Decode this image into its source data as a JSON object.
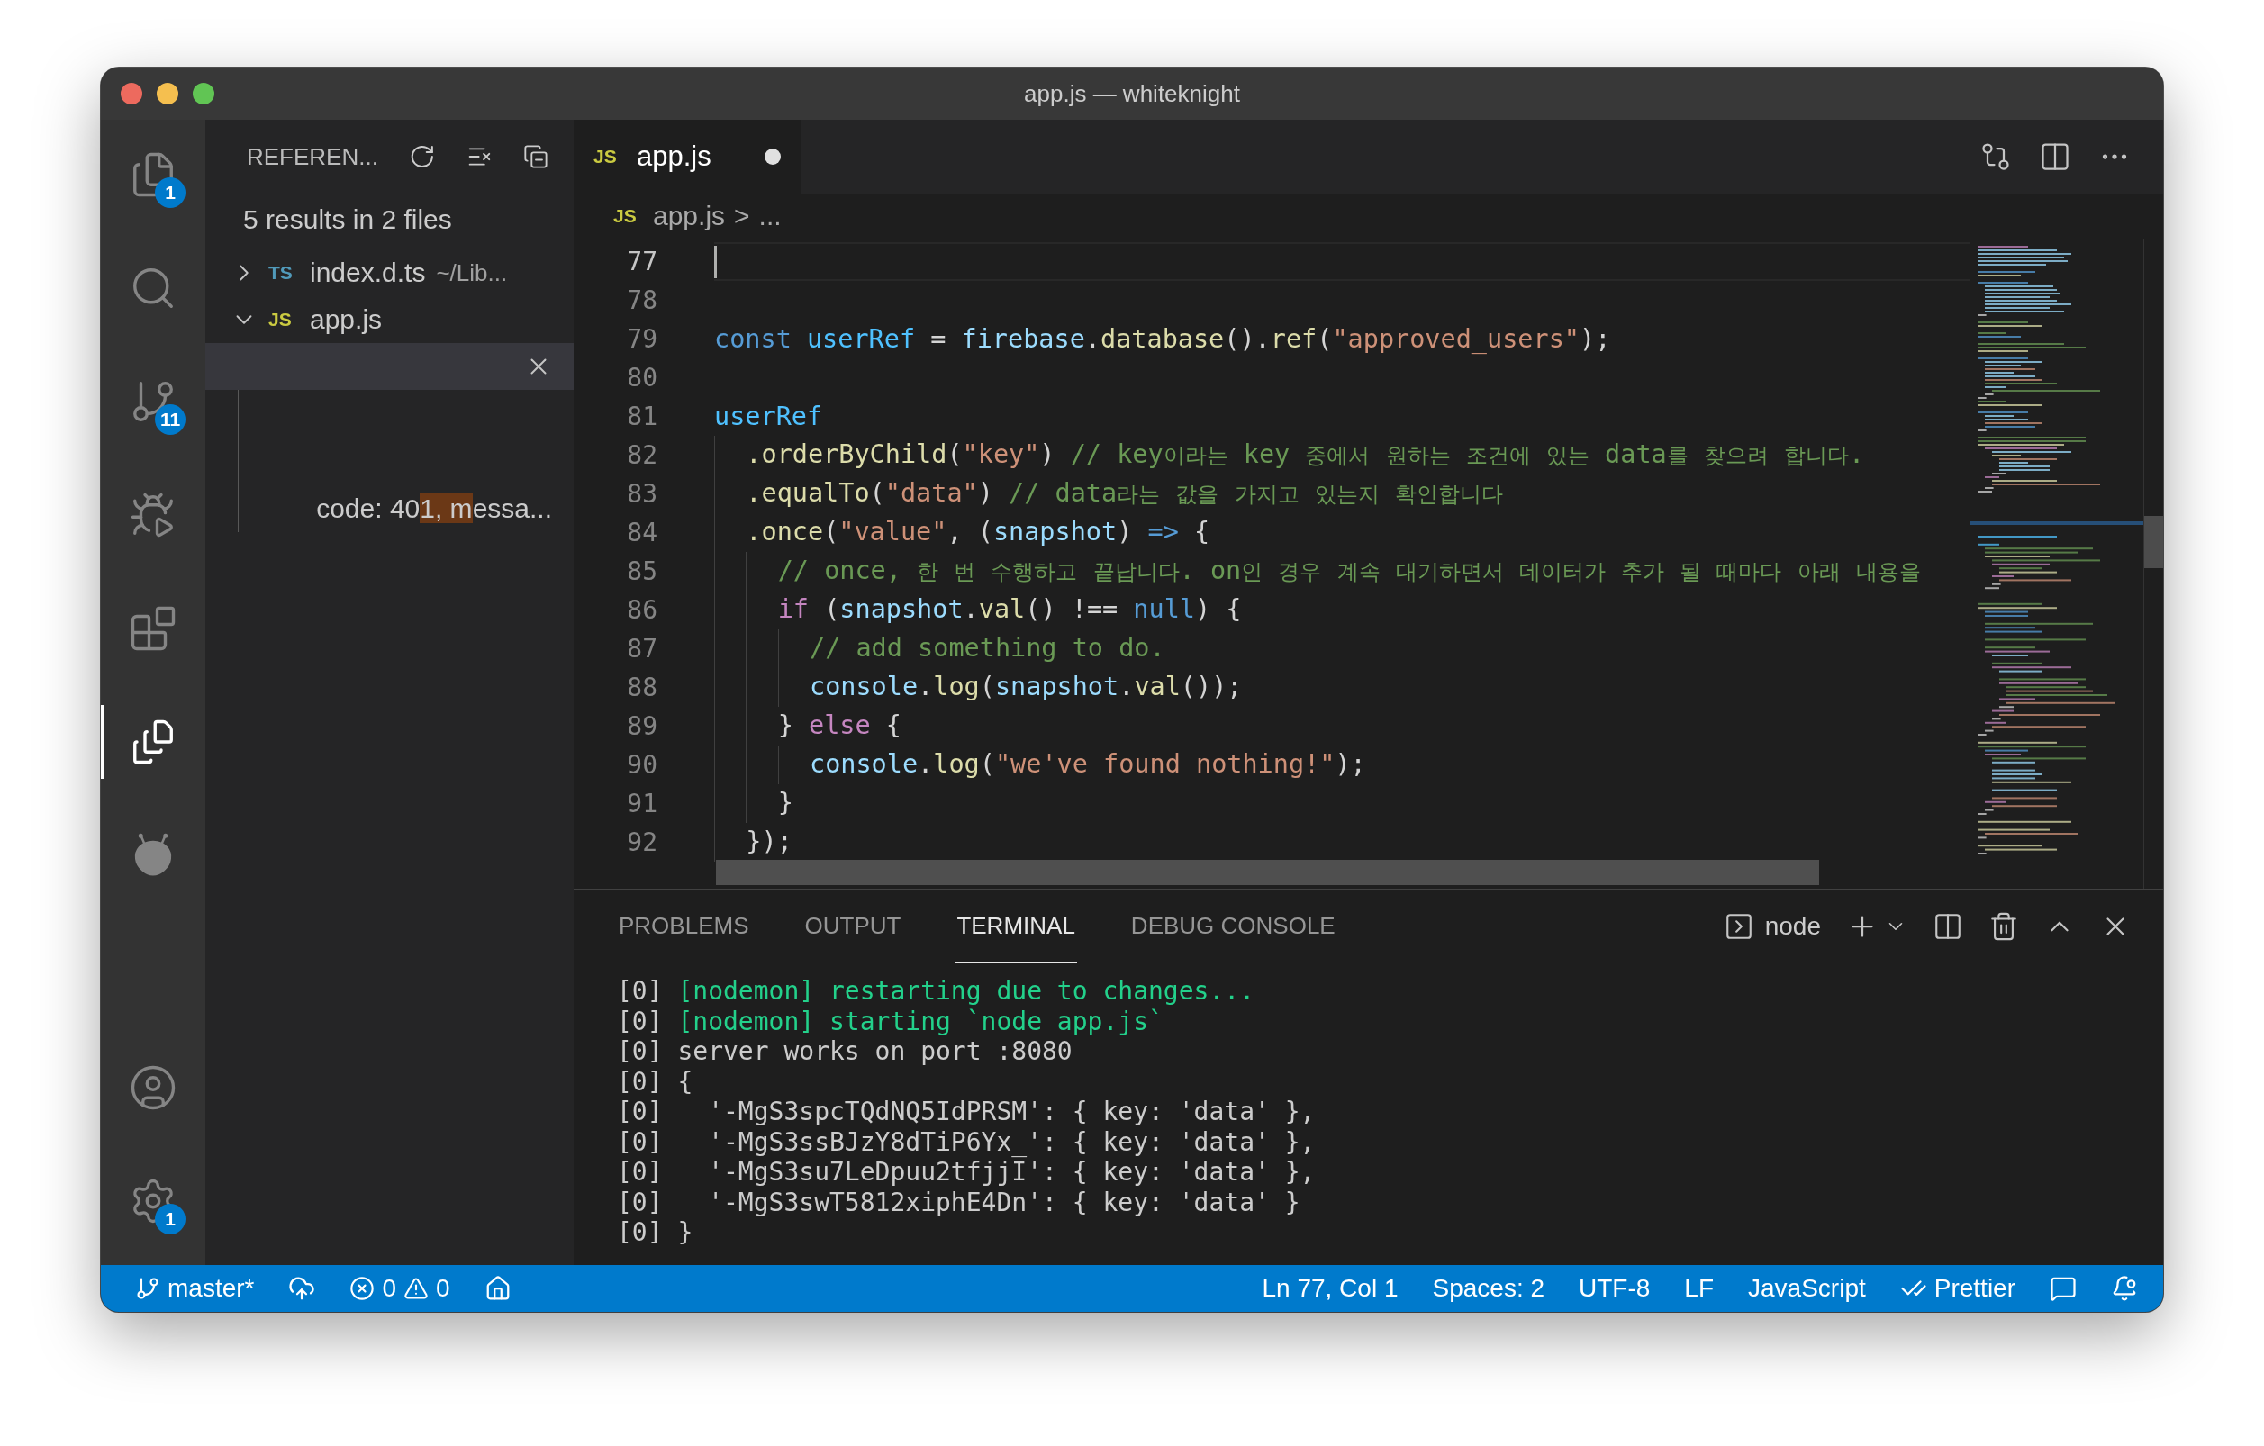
{
  "window": {
    "title": "app.js — whiteknight"
  },
  "activity_bar": {
    "top": [
      {
        "kind": "explorer",
        "badge": "1",
        "selected": false
      },
      {
        "kind": "search",
        "selected": false
      },
      {
        "kind": "source-control",
        "badge": "11",
        "selected": false
      },
      {
        "kind": "run-debug",
        "selected": false
      },
      {
        "kind": "extensions",
        "selected": false
      },
      {
        "kind": "references",
        "selected": true
      },
      {
        "kind": "alien",
        "selected": false
      }
    ],
    "bottom": [
      {
        "kind": "account",
        "selected": false
      },
      {
        "kind": "settings",
        "badge": "1",
        "selected": false
      }
    ]
  },
  "sidebar": {
    "title": "REFEREN...",
    "summary": "5 results in 2 files",
    "files": [
      {
        "badge": "TS",
        "name": "index.d.ts",
        "description": "~/Lib...",
        "expanded": false
      },
      {
        "badge": "JS",
        "name": "app.js",
        "expanded": true,
        "children": [
          {
            "selected": true,
            "close": true
          },
          {
            "selected": false,
            "before": "code: 40",
            "match": "1, m",
            "after": "essa..."
          }
        ]
      }
    ]
  },
  "editor": {
    "tab": {
      "badge": "JS",
      "label": "app.js",
      "modified": true
    },
    "breadcrumb": {
      "badge": "JS",
      "file": "app.js",
      "separator": ">",
      "rest": "..."
    },
    "lines": [
      {
        "number": "77",
        "current": true
      },
      {
        "number": "78",
        "current": false
      },
      {
        "number": "79",
        "current": false,
        "tokens": [
          {
            "kind": "keyword",
            "text": "const "
          },
          {
            "kind": "constant",
            "text": "userRef"
          },
          {
            "kind": "plain",
            "text": " = "
          },
          {
            "kind": "variable",
            "text": "firebase"
          },
          {
            "kind": "plain",
            "text": "."
          },
          {
            "kind": "function",
            "text": "database"
          },
          {
            "kind": "plain",
            "text": "()."
          },
          {
            "kind": "function",
            "text": "ref"
          },
          {
            "kind": "plain",
            "text": "("
          },
          {
            "kind": "string",
            "text": "\"approved_users\""
          },
          {
            "kind": "plain",
            "text": ");"
          }
        ]
      },
      {
        "number": "80",
        "current": false
      },
      {
        "number": "81",
        "current": false,
        "tokens": [
          {
            "kind": "constant",
            "text": "userRef"
          }
        ]
      },
      {
        "number": "82",
        "current": false,
        "tokens": [
          {
            "kind": "function",
            "text": "  .orderByChild"
          },
          {
            "kind": "plain",
            "text": "("
          },
          {
            "kind": "string",
            "text": "\"key\""
          },
          {
            "kind": "plain",
            "text": ") "
          },
          {
            "kind": "comment",
            "text": "// key이라는 key 중에서 원하는 조건에 있는 data를 찾으려 합니다."
          }
        ]
      },
      {
        "number": "83",
        "current": false,
        "tokens": [
          {
            "kind": "function",
            "text": "  .equalTo"
          },
          {
            "kind": "plain",
            "text": "("
          },
          {
            "kind": "string",
            "text": "\"data\""
          },
          {
            "kind": "plain",
            "text": ") "
          },
          {
            "kind": "comment",
            "text": "// data라는 값을 가지고 있는지 확인합니다"
          }
        ]
      },
      {
        "number": "84",
        "current": false,
        "tokens": [
          {
            "kind": "function",
            "text": "  .once"
          },
          {
            "kind": "plain",
            "text": "("
          },
          {
            "kind": "string",
            "text": "\"value\""
          },
          {
            "kind": "plain",
            "text": ", ("
          },
          {
            "kind": "variable",
            "text": "snapshot"
          },
          {
            "kind": "plain",
            "text": ") "
          },
          {
            "kind": "keyword",
            "text": "=>"
          },
          {
            "kind": "plain",
            "text": " {"
          }
        ]
      },
      {
        "number": "85",
        "current": false,
        "tokens": [
          {
            "kind": "comment",
            "text": "    // once, 한 번 수행하고 끝납니다. on인 경우 계속 대기하면서 데이터가 추가 될 때마다 아래 내용을"
          }
        ]
      },
      {
        "number": "86",
        "current": false,
        "tokens": [
          {
            "kind": "control",
            "text": "    if"
          },
          {
            "kind": "plain",
            "text": " ("
          },
          {
            "kind": "variable",
            "text": "snapshot"
          },
          {
            "kind": "plain",
            "text": "."
          },
          {
            "kind": "function",
            "text": "val"
          },
          {
            "kind": "plain",
            "text": "() !== "
          },
          {
            "kind": "keyword",
            "text": "null"
          },
          {
            "kind": "plain",
            "text": ") {"
          }
        ]
      },
      {
        "number": "87",
        "current": false,
        "tokens": [
          {
            "kind": "comment",
            "text": "      // add something to do."
          }
        ]
      },
      {
        "number": "88",
        "current": false,
        "tokens": [
          {
            "kind": "variable",
            "text": "      console"
          },
          {
            "kind": "plain",
            "text": "."
          },
          {
            "kind": "function",
            "text": "log"
          },
          {
            "kind": "plain",
            "text": "("
          },
          {
            "kind": "variable",
            "text": "snapshot"
          },
          {
            "kind": "plain",
            "text": "."
          },
          {
            "kind": "function",
            "text": "val"
          },
          {
            "kind": "plain",
            "text": "());"
          }
        ]
      },
      {
        "number": "89",
        "current": false,
        "tokens": [
          {
            "kind": "plain",
            "text": "    } "
          },
          {
            "kind": "control",
            "text": "else"
          },
          {
            "kind": "plain",
            "text": " {"
          }
        ]
      },
      {
        "number": "90",
        "current": false,
        "tokens": [
          {
            "kind": "variable",
            "text": "      console"
          },
          {
            "kind": "plain",
            "text": "."
          },
          {
            "kind": "function",
            "text": "log"
          },
          {
            "kind": "plain",
            "text": "("
          },
          {
            "kind": "string",
            "text": "\"we've found nothing!\""
          },
          {
            "kind": "plain",
            "text": ");"
          }
        ]
      },
      {
        "number": "91",
        "current": false,
        "tokens": [
          {
            "kind": "plain",
            "text": "    }"
          }
        ]
      },
      {
        "number": "92",
        "current": false,
        "tokens": [
          {
            "kind": "plain",
            "text": "  });"
          }
        ]
      }
    ]
  },
  "panel": {
    "tabs": [
      {
        "label": "PROBLEMS",
        "selected": false
      },
      {
        "label": "OUTPUT",
        "selected": false
      },
      {
        "label": "TERMINAL",
        "selected": true
      },
      {
        "label": "DEBUG CONSOLE",
        "selected": false
      }
    ],
    "terminal_name": "node",
    "terminal": [
      {
        "prefix": "[0]",
        "kind": "nodemon",
        "text": " [nodemon] restarting due to changes..."
      },
      {
        "prefix": "[0]",
        "kind": "nodemon",
        "text": " [nodemon] starting `node app.js`"
      },
      {
        "prefix": "[0]",
        "kind": "plain",
        "text": " server works on port :8080"
      },
      {
        "prefix": "[0]",
        "kind": "plain",
        "text": " {"
      },
      {
        "prefix": "[0]",
        "kind": "plain",
        "text": "   '-MgS3spcTQdNQ5IdPRSM': { key: 'data' },"
      },
      {
        "prefix": "[0]",
        "kind": "plain",
        "text": "   '-MgS3ssBJzY8dTiP6Yx_': { key: 'data' },"
      },
      {
        "prefix": "[0]",
        "kind": "plain",
        "text": "   '-MgS3su7LeDpuu2tfjjI': { key: 'data' },"
      },
      {
        "prefix": "[0]",
        "kind": "plain",
        "text": "   '-MgS3swT5812xiphE4Dn': { key: 'data' }"
      },
      {
        "prefix": "[0]",
        "kind": "plain",
        "text": " }"
      }
    ]
  },
  "status_bar": {
    "branch": "master*",
    "errors": "0",
    "warnings": "0",
    "right": [
      {
        "kind": "text",
        "text": "Ln 77, Col 1"
      },
      {
        "kind": "text",
        "text": "Spaces: 2"
      },
      {
        "kind": "text",
        "text": "UTF-8"
      },
      {
        "kind": "text",
        "text": "LF"
      },
      {
        "kind": "text",
        "text": "JavaScript"
      },
      {
        "kind": "check",
        "text": "Prettier"
      }
    ]
  }
}
